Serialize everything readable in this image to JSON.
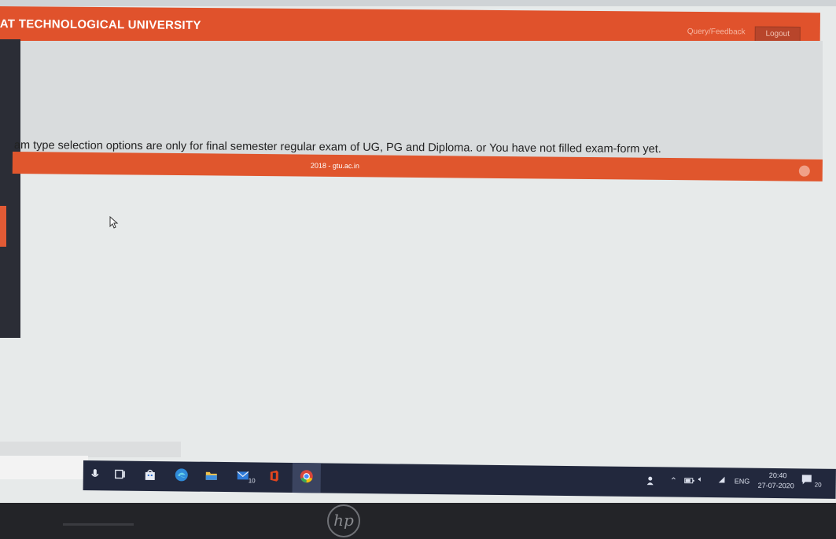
{
  "header": {
    "title": "AT TECHNOLOGICAL UNIVERSITY",
    "query_feedback_label": "Query/Feedback",
    "logout_label": "Logout"
  },
  "main": {
    "message": "am type selection options are only for final semester regular exam of UG, PG and Diploma. or You have not filled exam-form yet."
  },
  "footer": {
    "text": "2018 - gtu.ac.in"
  },
  "taskbar": {
    "icons": [
      "microphone-icon",
      "task-view-icon",
      "store-icon",
      "edge-icon",
      "file-explorer-icon",
      "mail-icon",
      "office-icon",
      "chrome-icon"
    ],
    "mail_badge": "10",
    "language": "ENG",
    "time": "20:40",
    "date": "27-07-2020",
    "notification_count": "20"
  },
  "colors": {
    "brand": "#e0522c",
    "taskbar": "#22283d"
  },
  "device": {
    "logo": "hp"
  }
}
